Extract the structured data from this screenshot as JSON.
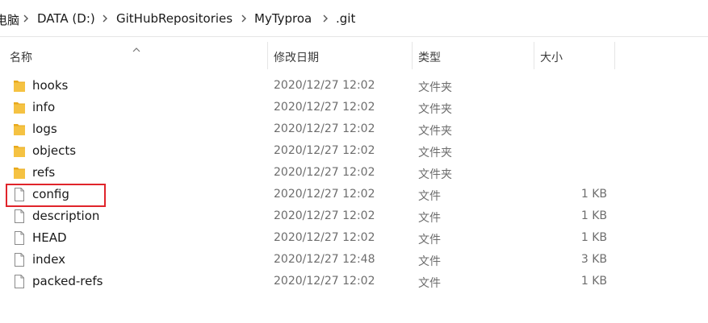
{
  "breadcrumb": {
    "items": [
      "电脑",
      "DATA (D:)",
      "GitHubRepositories",
      "MyTyproa",
      ".git"
    ]
  },
  "columns": {
    "name": "名称",
    "modified": "修改日期",
    "type": "类型",
    "size": "大小"
  },
  "files": [
    {
      "name": "hooks",
      "modified": "2020/12/27 12:02",
      "type": "文件夹",
      "size": "",
      "icon": "folder-icon"
    },
    {
      "name": "info",
      "modified": "2020/12/27 12:02",
      "type": "文件夹",
      "size": "",
      "icon": "folder-icon"
    },
    {
      "name": "logs",
      "modified": "2020/12/27 12:02",
      "type": "文件夹",
      "size": "",
      "icon": "folder-icon"
    },
    {
      "name": "objects",
      "modified": "2020/12/27 12:02",
      "type": "文件夹",
      "size": "",
      "icon": "folder-icon"
    },
    {
      "name": "refs",
      "modified": "2020/12/27 12:02",
      "type": "文件夹",
      "size": "",
      "icon": "folder-icon"
    },
    {
      "name": "config",
      "modified": "2020/12/27 12:02",
      "type": "文件",
      "size": "1 KB",
      "icon": "file-icon"
    },
    {
      "name": "description",
      "modified": "2020/12/27 12:02",
      "type": "文件",
      "size": "1 KB",
      "icon": "file-icon"
    },
    {
      "name": "HEAD",
      "modified": "2020/12/27 12:02",
      "type": "文件",
      "size": "1 KB",
      "icon": "file-icon"
    },
    {
      "name": "index",
      "modified": "2020/12/27 12:48",
      "type": "文件",
      "size": "3 KB",
      "icon": "file-icon"
    },
    {
      "name": "packed-refs",
      "modified": "2020/12/27 12:02",
      "type": "文件",
      "size": "1 KB",
      "icon": "file-icon"
    }
  ],
  "colors": {
    "folder": "#f5c242",
    "highlight": "#e0242b"
  }
}
